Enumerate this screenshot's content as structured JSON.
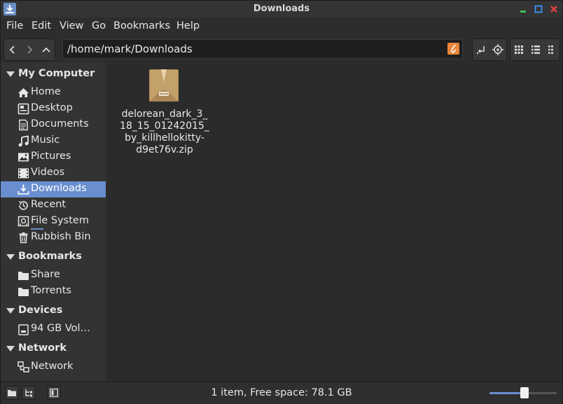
{
  "window": {
    "title": "Downloads"
  },
  "menu": {
    "items": [
      "File",
      "Edit",
      "View",
      "Go",
      "Bookmarks",
      "Help"
    ]
  },
  "toolbar": {
    "nav_buttons": [
      "back-icon",
      "forward-icon",
      "up-icon"
    ],
    "path": "/home/mark/Downloads",
    "view_buttons": [
      "icon-view-icon",
      "list-view-icon",
      "compact-view-icon"
    ]
  },
  "sidebar": {
    "sections": [
      {
        "title": "My Computer",
        "items": [
          "Home",
          "Desktop",
          "Documents",
          "Music",
          "Pictures",
          "Videos",
          "Downloads",
          "Recent",
          "File System",
          "Rubbish Bin"
        ]
      },
      {
        "title": "Bookmarks",
        "items": [
          "Share",
          "Torrents"
        ]
      },
      {
        "title": "Devices",
        "items": [
          "94 GB Vol…"
        ]
      },
      {
        "title": "Network",
        "items": [
          "Network"
        ]
      }
    ],
    "selected": "Downloads"
  },
  "files": [
    {
      "name": "delorean_dark_3_18_15_01242015_by_killhellokitty-d9et76v.zip",
      "icon": "zip-archive-icon"
    }
  ],
  "status": {
    "text": "1 item, Free space: 78.1 GB",
    "zoom_fraction": 0.52
  },
  "colors": {
    "accent": "#6a8fd0",
    "clear_button": "#e8853a"
  }
}
